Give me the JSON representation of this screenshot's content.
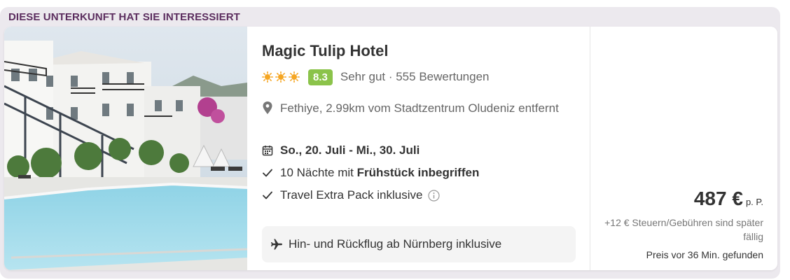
{
  "banner": {
    "title": "DIESE UNTERKUNFT HAT SIE INTERESSIERT"
  },
  "hotel": {
    "name": "Magic Tulip Hotel",
    "stars": 3,
    "star_color": "#f5a623",
    "score": "8.3",
    "score_color": "#8bc34a",
    "rating_text": "Sehr gut · 555 Bewertungen",
    "location": "Fethiye, 2.99km vom Stadtzentrum Oludeniz entfernt",
    "dates": "So., 20. Juli - Mi., 30. Juli",
    "nights_prefix": "10 Nächte mit ",
    "nights_bold": "Frühstück inbegriffen",
    "extra_pack": "Travel Extra Pack inklusive",
    "flight": "Hin- und Rückflug ab Nürnberg inklusive"
  },
  "price": {
    "amount": "487 €",
    "unit": "p. P.",
    "tax": "+12 € Steuern/Gebühren sind später fällig",
    "found": "Preis vor 36 Min. gefunden"
  },
  "icons": {
    "star": "sun-star-icon",
    "location": "location-pin-icon",
    "calendar": "calendar-icon",
    "check": "check-icon",
    "info": "info-icon",
    "flight": "airplane-icon"
  }
}
